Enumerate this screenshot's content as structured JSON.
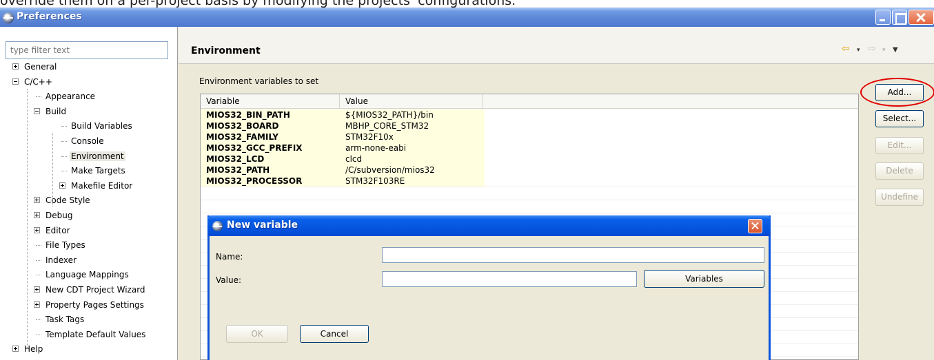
{
  "caption": "override them on a per-project basis by modifying the projects' configurations.",
  "window": {
    "title": "Preferences"
  },
  "filter": {
    "placeholder": "type filter text"
  },
  "tree": [
    {
      "label": "General",
      "toggle": "plus"
    },
    {
      "label": "C/C++",
      "toggle": "minus"
    },
    {
      "label": "Appearance"
    },
    {
      "label": "Build",
      "toggle": "minus"
    },
    {
      "label": "Build Variables"
    },
    {
      "label": "Console"
    },
    {
      "label": "Environment",
      "selected": true
    },
    {
      "label": "Make Targets"
    },
    {
      "label": "Makefile Editor",
      "toggle": "plus"
    },
    {
      "label": "Code Style",
      "toggle": "plus"
    },
    {
      "label": "Debug",
      "toggle": "plus"
    },
    {
      "label": "Editor",
      "toggle": "plus"
    },
    {
      "label": "File Types"
    },
    {
      "label": "Indexer"
    },
    {
      "label": "Language Mappings"
    },
    {
      "label": "New CDT Project Wizard",
      "toggle": "plus"
    },
    {
      "label": "Property Pages Settings",
      "toggle": "plus"
    },
    {
      "label": "Task Tags"
    },
    {
      "label": "Template Default Values"
    },
    {
      "label": "Help",
      "toggle": "plus"
    }
  ],
  "page": {
    "title": "Environment",
    "section_label": "Environment variables to set",
    "columns": [
      "Variable",
      "Value"
    ],
    "rows": [
      {
        "variable": "MIOS32_BIN_PATH",
        "value": "${MIOS32_PATH}/bin"
      },
      {
        "variable": "MIOS32_BOARD",
        "value": "MBHP_CORE_STM32"
      },
      {
        "variable": "MIOS32_FAMILY",
        "value": "STM32F10x"
      },
      {
        "variable": "MIOS32_GCC_PREFIX",
        "value": "arm-none-eabi"
      },
      {
        "variable": "MIOS32_LCD",
        "value": "clcd"
      },
      {
        "variable": "MIOS32_PATH",
        "value": "/C/subversion/mios32"
      },
      {
        "variable": "MIOS32_PROCESSOR",
        "value": "STM32F103RE"
      }
    ]
  },
  "buttons": {
    "add": "Add...",
    "select": "Select...",
    "edit": "Edit...",
    "delete": "Delete",
    "undefine": "Undefine"
  },
  "nav": {
    "back": "⇦",
    "forward": "⇨",
    "dropdown": "▾",
    "menu": "▼"
  },
  "dialog": {
    "title": "New variable",
    "name_label": "Name:",
    "value_label": "Value:",
    "name_value": "",
    "value_value": "",
    "variables_button": "Variables",
    "ok_button": "OK",
    "cancel_button": "Cancel"
  },
  "colors": {
    "highlight_row": "#ffffe0",
    "annotation": "#e00000",
    "titlebar": "#5c86d6"
  }
}
